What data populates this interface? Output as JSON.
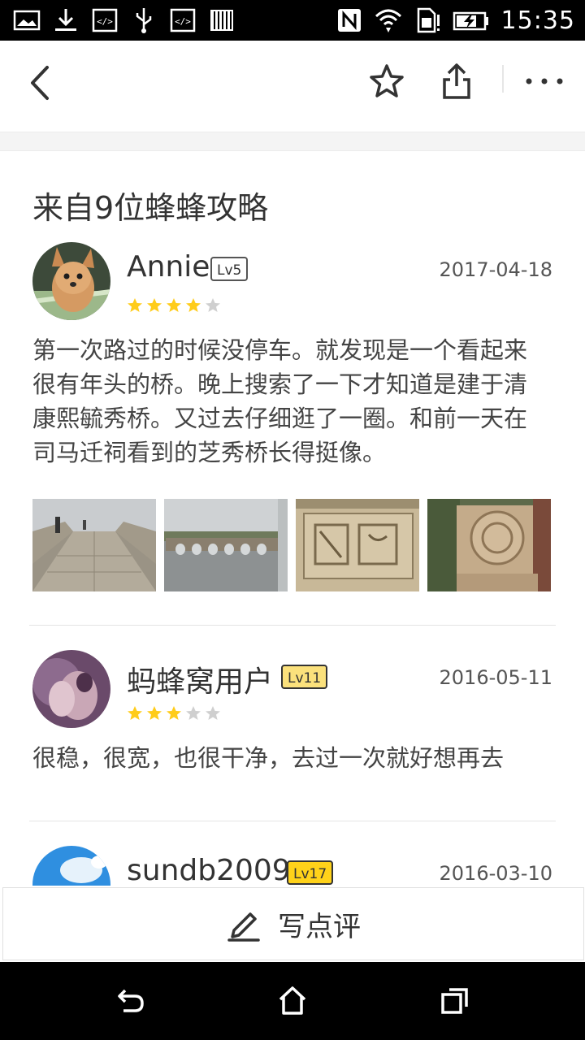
{
  "status_bar": {
    "time": "15:35",
    "left_icons": [
      "image-icon",
      "download-icon",
      "code-icon",
      "usb-icon",
      "code-icon",
      "barcode-icon"
    ],
    "right_icons": [
      "nfc-icon",
      "wifi-icon",
      "sim-alert-icon",
      "battery-charging-icon"
    ]
  },
  "top_nav": {
    "back_icon": "chevron-left-icon",
    "favorite_icon": "star-outline-icon",
    "share_icon": "share-icon",
    "more_icon": "more-horizontal-icon"
  },
  "section_title": "来自9位蜂蜂攻略",
  "reviews": [
    {
      "username": "Annie",
      "level": "Lv5",
      "date": "2017-04-18",
      "rating": 4,
      "text_lines": [
        "第一次路过的时候没停车。就发现是一个看起来",
        "很有年头的桥。晚上搜索了一下才知道是建于清",
        "康熙毓秀桥。又过去仔细逛了一圈。和前一天在",
        "司马迁祠看到的芝秀桥长得挺像。"
      ],
      "photos": [
        "stone-bridge-deck-photo",
        "arched-bridge-river-photo",
        "carved-stone-panel-photo",
        "carved-stone-medallion-photo"
      ]
    },
    {
      "username": "蚂蜂窝用户",
      "level": "Lv11",
      "date": "2016-05-11",
      "rating": 3,
      "text_lines": [
        "很稳，很宽，也很干净，去过一次就好想再去"
      ]
    },
    {
      "username": "sundb2009",
      "level": "Lv17",
      "date": "2016-03-10",
      "rating": 0
    }
  ],
  "bottom_bar": {
    "icon": "pencil-icon",
    "label": "写点评"
  },
  "android_nav": [
    "back-icon",
    "home-icon",
    "recents-icon"
  ],
  "colors": {
    "star_filled": "#FFCC1A",
    "star_empty": "#CFCFCF",
    "text_primary": "#333333"
  }
}
